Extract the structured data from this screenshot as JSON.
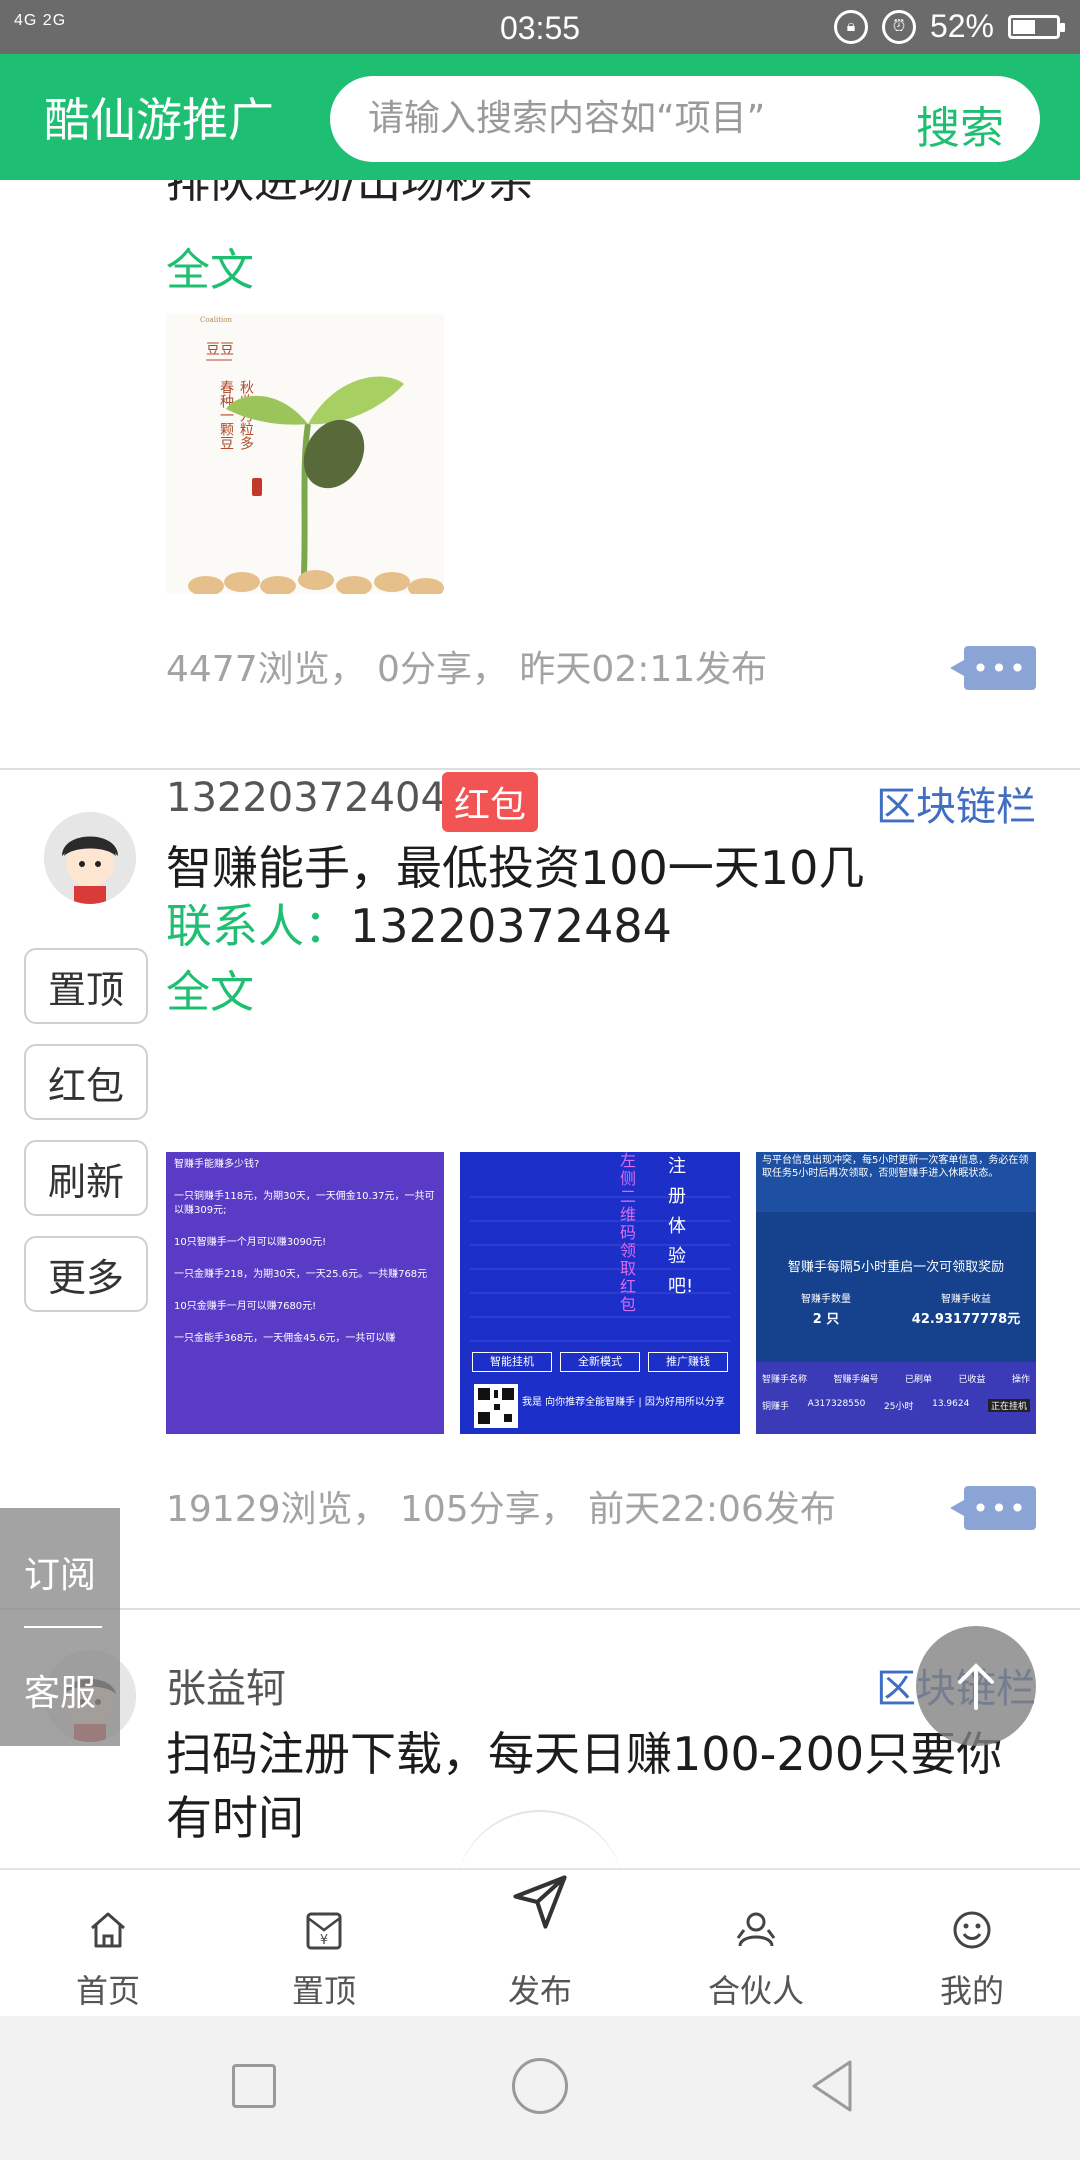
{
  "status_bar": {
    "signal": "4G 2G",
    "time": "03:55",
    "battery": "52%",
    "battery_level": 0.52
  },
  "header": {
    "app_title": "酷仙游推广",
    "search_placeholder": "请输入搜索内容如“项目”",
    "search_button": "搜索"
  },
  "posts": [
    {
      "partial_title": "排队进场/出场秒杀",
      "fulltext_label": "全文",
      "thumbnail_text": {
        "tag": "Coalition",
        "name": "豆豆",
        "lines": [
          "秋收万粒多",
          "春种一颗豆"
        ]
      },
      "stats": "4477浏览， 0分享， 昨天02:11发布"
    },
    {
      "poster": "13220372404",
      "badge": "红包",
      "category": "区块链栏",
      "title": "智赚能手，最低投资100一天10几",
      "contact_label": "联系人：",
      "contact_value": "13220372484",
      "fulltext_label": "全文",
      "side_actions": [
        "置顶",
        "红包",
        "刷新",
        "更多"
      ],
      "images": [
        {
          "lines": [
            "智赚手能赚多少钱?",
            "一只铜赚手118元，为期30天，一天佣金10.37元，一共可以赚309元;",
            "10只智赚手一个月可以赚3090元!",
            "一只金赚手218，为期30天，一天25.6元。一共赚768元",
            "10只金赚手一月可以赚7680元!",
            "一只金能手368元，一天佣金45.6元，一共可以赚"
          ]
        },
        {
          "vertical_text": "左侧二维码领取红包",
          "right_text": "注册体验吧!",
          "buttons": [
            "智能挂机",
            "全新模式",
            "推广赚钱"
          ],
          "footer": "我是 向你推荐全能智赚手 | 因为好用所以分享"
        },
        {
          "top_text": "与平台信息出现冲突，每5小时更新一次客单信息，务必在领取任务5小时后再次领取，否则智赚手进入休眠状态。",
          "headline": "智赚手每隔5小时重启一次可领取奖励",
          "count_label": "智赚手数量",
          "count_value": "2 只",
          "income_label": "智赚手收益",
          "income_value": "42.93177778元",
          "table_headers": [
            "智赚手名称",
            "智赚手编号",
            "已刷单",
            "已收益",
            "操作"
          ],
          "table_row": [
            "铜赚手",
            "A317328550",
            "25小时",
            "13.9624",
            "正在挂机"
          ]
        }
      ],
      "stats": "19129浏览， 105分享， 前天22:06发布"
    },
    {
      "poster": "张益轲",
      "category": "区块链栏",
      "title": "扫码注册下载，每天日赚100-200只要你有时间"
    }
  ],
  "float_panel": {
    "subscribe": "订阅",
    "service": "客服"
  },
  "bottom_nav": [
    {
      "label": "首页",
      "icon": "home-icon"
    },
    {
      "label": "置顶",
      "icon": "pin-envelope-icon"
    },
    {
      "label": "发布",
      "icon": "send-arrow-icon"
    },
    {
      "label": "合伙人",
      "icon": "partner-icon"
    },
    {
      "label": "我的",
      "icon": "smile-icon"
    }
  ],
  "colors": {
    "brand_green": "#1ebf72",
    "link_blue": "#3f6ec2",
    "badge_red": "#f25353",
    "purple_card": "#5a3bc6",
    "blue_card": "#1c2fc9"
  }
}
